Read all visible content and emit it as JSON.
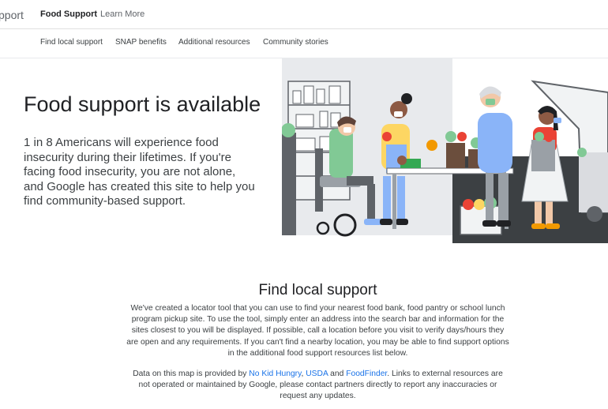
{
  "header": {
    "brand": "pport",
    "nav": [
      {
        "label": "Food Support"
      },
      {
        "label": "Learn More"
      }
    ]
  },
  "subnav": [
    {
      "label": "Find local support"
    },
    {
      "label": "SNAP benefits"
    },
    {
      "label": "Additional resources"
    },
    {
      "label": "Community stories"
    }
  ],
  "hero": {
    "title": "Food support is available",
    "body": "1 in 8 Americans will experience food insecurity during their lifetimes. If you're facing food insecurity, you are not alone, and Google has created this site to help you find community-based support."
  },
  "locator": {
    "title": "Find local support",
    "intro": "We've created a locator tool that you can use to find your nearest food bank, food pantry or school lunch program pickup site. To use the tool, simply enter an address into the search bar and information for the sites closest to you will be displayed. If possible, call a location before you visit to verify days/hours they are open and any requirements. If you can't find a nearby location, you may be able to find support options in the additional food support resources list below.",
    "data_prefix": "Data on this map is provided by ",
    "link_1": "No Kid Hungry",
    "sep_1": ", ",
    "link_2": "USDA",
    "sep_2": " and ",
    "link_3": "FoodFinder",
    "data_suffix": ". Links to external resources are not operated or maintained by Google, please contact partners directly to report any inaccuracies or request any updates."
  },
  "colors": {
    "accent": "#1a73e8",
    "text": "#202124",
    "illustration_green": "#81c995",
    "illustration_yellow": "#fdd663",
    "illustration_blue": "#8ab4f8"
  }
}
